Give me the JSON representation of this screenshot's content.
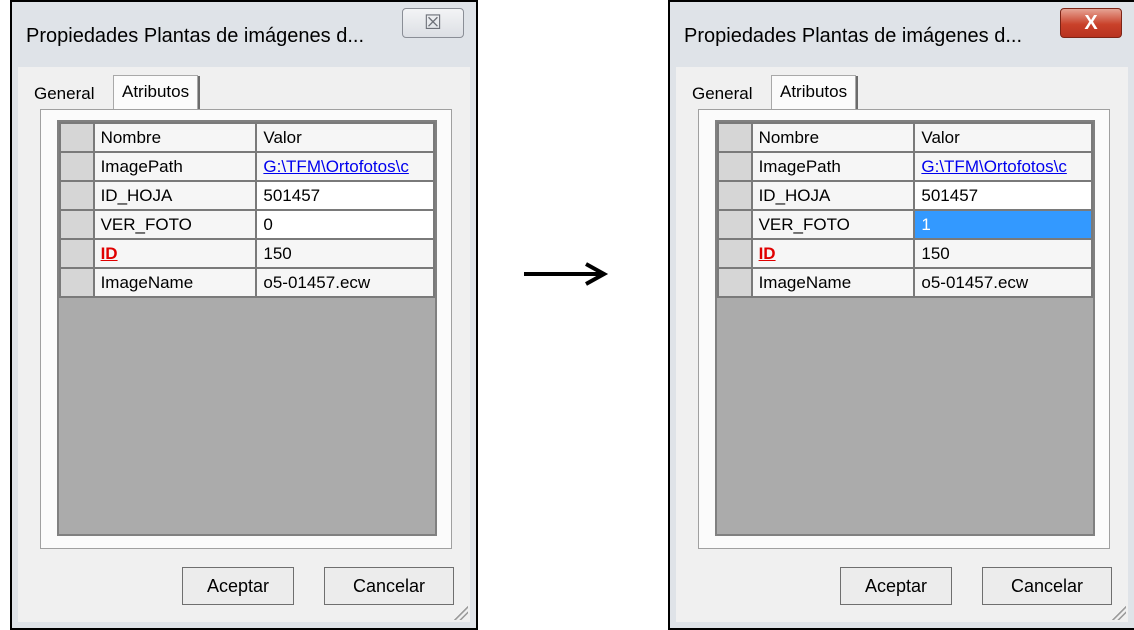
{
  "arrow_icon": "right-arrow",
  "dialogs": [
    {
      "title": "Propiedades Plantas de imágenes d...",
      "close_glyph": "☒",
      "tabs": [
        "General",
        "Atributos"
      ],
      "columns": [
        "Nombre",
        "Valor"
      ],
      "rows": [
        {
          "name": "ImagePath",
          "value": "G:\\TFM\\Ortofotos\\c"
        },
        {
          "name": "ID_HOJA",
          "value": "501457"
        },
        {
          "name": "VER_FOTO",
          "value": "0"
        },
        {
          "name": "ID",
          "value": "150"
        },
        {
          "name": "ImageName",
          "value": "o5-01457.ecw"
        }
      ],
      "ok_label": "Aceptar",
      "cancel_label": "Cancelar"
    },
    {
      "title": "Propiedades Plantas de imágenes d...",
      "close_glyph": "X",
      "tabs": [
        "General",
        "Atributos"
      ],
      "columns": [
        "Nombre",
        "Valor"
      ],
      "rows": [
        {
          "name": "ImagePath",
          "value": "G:\\TFM\\Ortofotos\\c"
        },
        {
          "name": "ID_HOJA",
          "value": "501457"
        },
        {
          "name": "VER_FOTO",
          "value": "1"
        },
        {
          "name": "ID",
          "value": "150"
        },
        {
          "name": "ImageName",
          "value": "o5-01457.ecw"
        }
      ],
      "ok_label": "Aceptar",
      "cancel_label": "Cancelar"
    }
  ]
}
